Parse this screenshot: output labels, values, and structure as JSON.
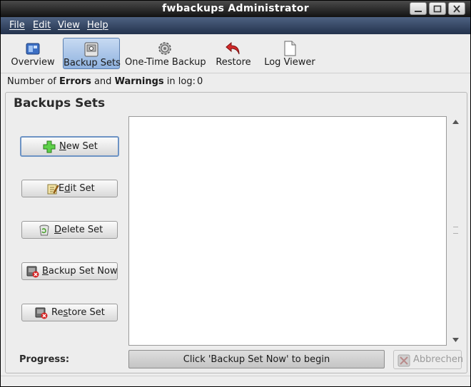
{
  "window": {
    "title": "fwbackups Administrator"
  },
  "menubar": {
    "items": [
      "File",
      "Edit",
      "View",
      "Help"
    ]
  },
  "toolbar": {
    "items": [
      {
        "label": "Overview",
        "icon": "overview-icon"
      },
      {
        "label": "Backup Sets",
        "icon": "backup-sets-icon",
        "active": true
      },
      {
        "label": "One-Time Backup",
        "icon": "gear-icon"
      },
      {
        "label": "Restore",
        "icon": "undo-arrow-icon"
      },
      {
        "label": "Log Viewer",
        "icon": "document-icon"
      }
    ]
  },
  "log_status": {
    "prefix": "Number of",
    "errors": "Errors",
    "and": "and",
    "warnings": "Warnings",
    "suffix": "in log:",
    "count": "0"
  },
  "panel": {
    "title": "Backups Sets",
    "buttons": [
      {
        "label": "New Set",
        "icon": "green-plus-icon"
      },
      {
        "label": "Edit Set",
        "icon": "edit-note-icon"
      },
      {
        "label": "Delete Set",
        "icon": "trash-icon"
      },
      {
        "label": "Backup Set Now",
        "icon": "backup-now-icon"
      },
      {
        "label": "Restore Set",
        "icon": "restore-icon"
      }
    ]
  },
  "progress": {
    "label": "Progress:",
    "text": "Click 'Backup Set Now' to begin",
    "fraction": 0
  },
  "cancel_button": {
    "label": "Abbrechen",
    "enabled": false
  },
  "colors": {
    "menubar": "#2f4161",
    "active_tool": "#a9c5ea",
    "window_bg": "#ededed"
  }
}
